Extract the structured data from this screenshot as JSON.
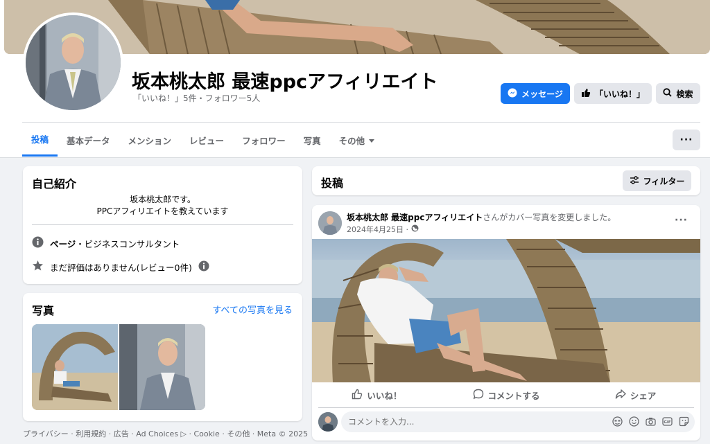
{
  "page": {
    "name": "坂本桃太郎 最速ppcアフィリエイト",
    "stats": "「いいね！」5件・フォロワー5人"
  },
  "actions": {
    "message_label": "メッセージ",
    "like_label": "「いいね！」",
    "search_label": "検索",
    "more_label": "···"
  },
  "tabs": [
    {
      "label": "投稿"
    },
    {
      "label": "基本データ"
    },
    {
      "label": "メンション"
    },
    {
      "label": "レビュー"
    },
    {
      "label": "フォロワー"
    },
    {
      "label": "写真"
    },
    {
      "label": "その他"
    }
  ],
  "intro": {
    "title": "自己紹介",
    "bio_line1": "坂本桃太郎です。",
    "bio_line2": "PPCアフィリエイトを教えています",
    "page_label": "ページ",
    "page_category": "・ビジネスコンサルタント",
    "rating_text": "まだ評価はありません(レビュー0件)"
  },
  "photos": {
    "title": "写真",
    "see_all": "すべての写真を見る"
  },
  "footer": {
    "text": "プライバシー · 利用規約 · 広告 · Ad Choices ▷ · Cookie · その他 · Meta © 2025"
  },
  "posts": {
    "title": "投稿",
    "filter_label": "フィルター"
  },
  "post": {
    "author": "坂本桃太郎 最速ppcアフィリエイト",
    "action_text": "さんがカバー写真を変更しました。",
    "date": "2024年4月25日 ·",
    "like_label": "いいね！",
    "comment_label": "コメントする",
    "share_label": "シェア",
    "comment_placeholder": "コメントを入力..."
  },
  "colors": {
    "accent": "#1877f2",
    "background": "#f0f2f5",
    "secondary_text": "#65676b"
  }
}
